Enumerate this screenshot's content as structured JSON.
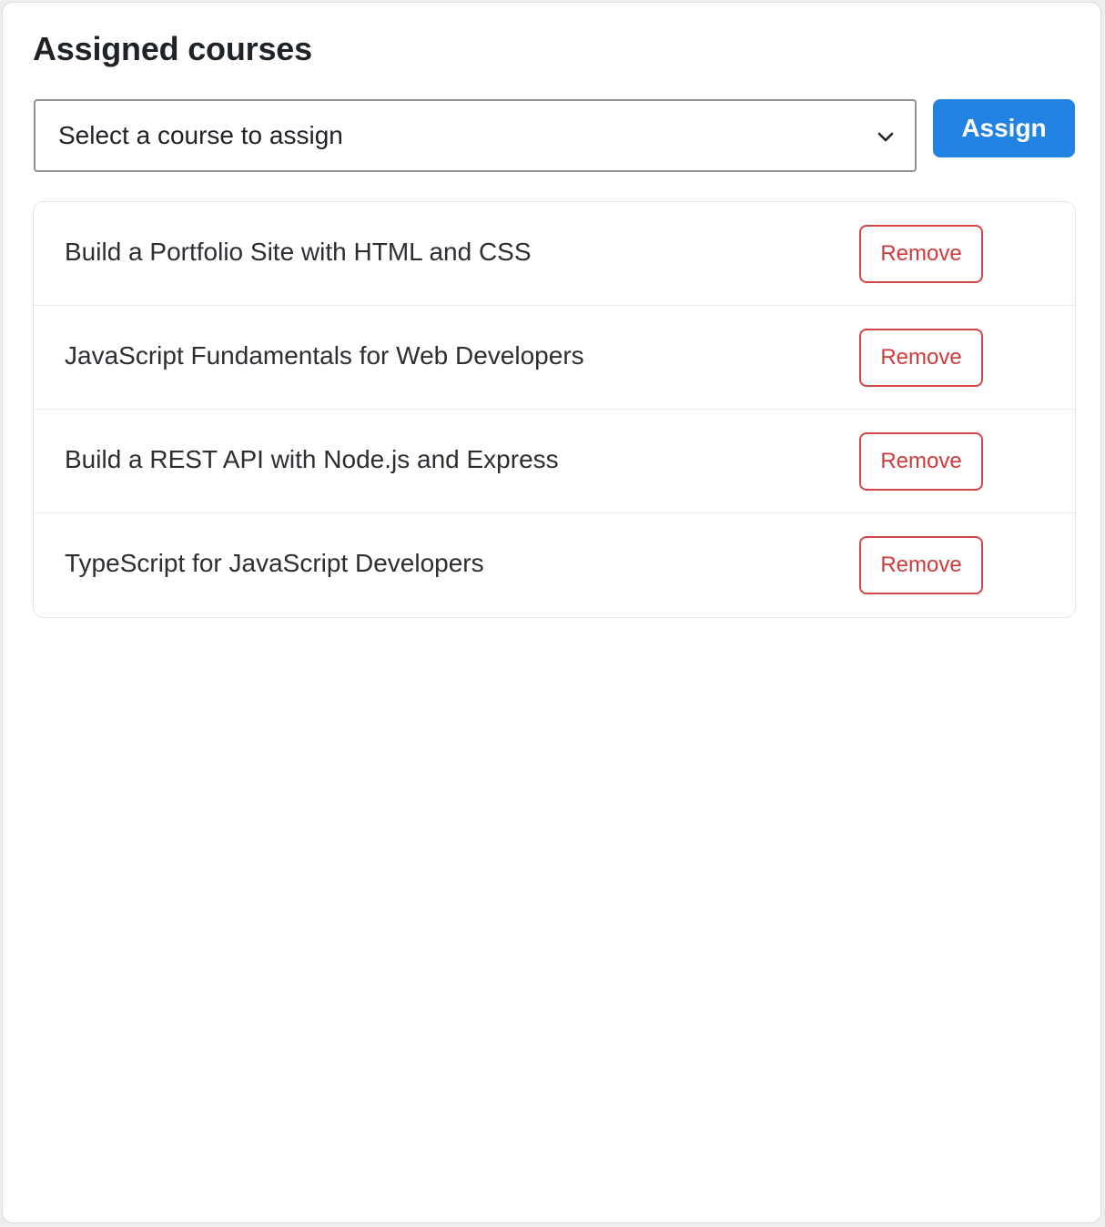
{
  "header": {
    "title": "Assigned courses"
  },
  "course_select": {
    "selected_value": "Select a course to assign",
    "icon": "chevron-down-icon"
  },
  "assign_button": {
    "label": "Assign"
  },
  "courses": [
    {
      "name": "Build a Portfolio Site with HTML and CSS",
      "remove_label": "Remove"
    },
    {
      "name": "JavaScript Fundamentals for Web Developers",
      "remove_label": "Remove"
    },
    {
      "name": "Build a REST API with Node.js and Express",
      "remove_label": "Remove"
    },
    {
      "name": "TypeScript for JavaScript Developers",
      "remove_label": "Remove"
    }
  ],
  "colors": {
    "primary": "#2383e2",
    "danger": "#d64545",
    "text": "#1f2328",
    "border": "#8c9196"
  }
}
